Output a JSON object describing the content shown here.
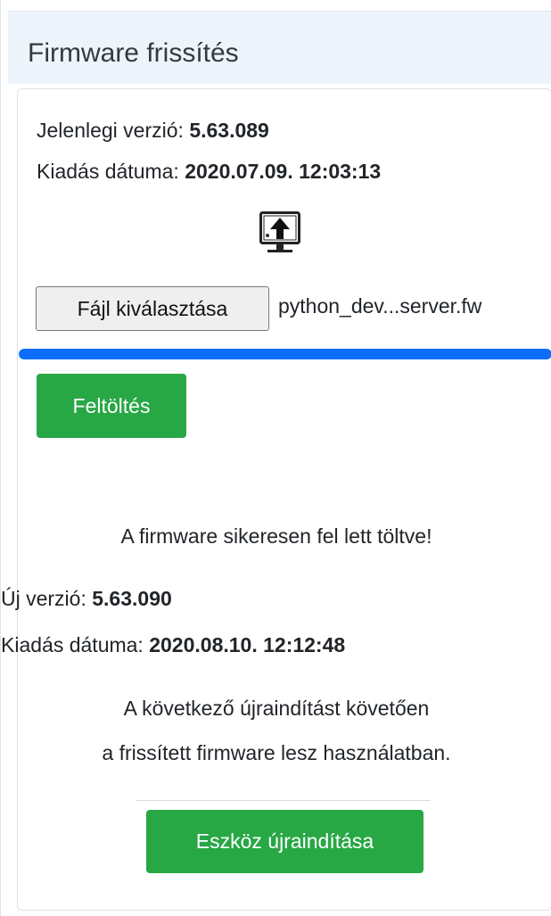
{
  "header": {
    "title": "Firmware frissítés"
  },
  "current": {
    "version_label": "Jelenlegi verzió: ",
    "version_value": "5.63.089",
    "date_label": "Kiadás dátuma: ",
    "date_value": "2020.07.09. 12:03:13"
  },
  "upload_icon": "upload-to-device-icon",
  "file_input": {
    "button_label": "Fájl kiválasztása",
    "file_name": "python_dev...server.fw"
  },
  "progress": {
    "fraction": 1.0,
    "color": "#0d6efd"
  },
  "upload_button": {
    "label": "Feltöltés",
    "color": "#28a745"
  },
  "result": {
    "success_message": "A firmware sikeresen fel lett töltve!",
    "new_version_label": "Új verzió: ",
    "new_version_value": "5.63.090",
    "date_label": "Kiadás dátuma: ",
    "date_value": "2020.08.10. 12:12:48",
    "note_line1": "A következő újraindítást követően",
    "note_line2": "a frissített firmware lesz használatban."
  },
  "restart_button": {
    "label": "Eszköz újraindítása",
    "color": "#28a745"
  }
}
